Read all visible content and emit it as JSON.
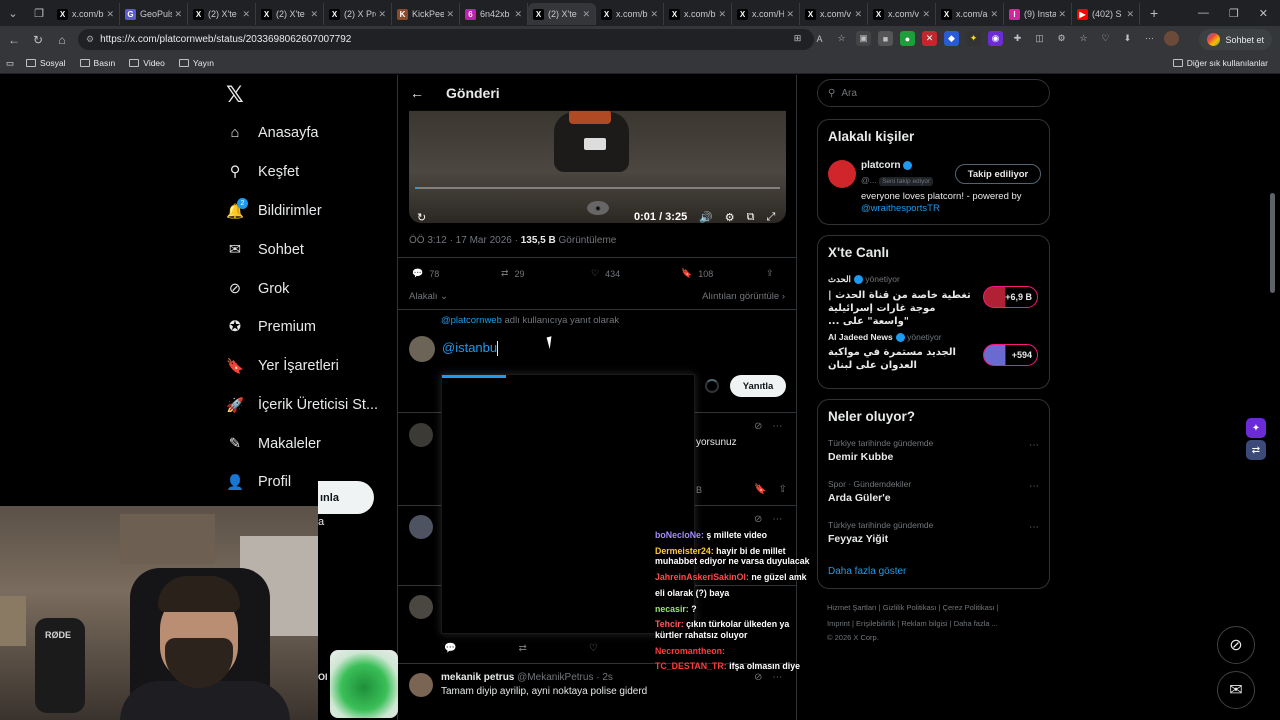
{
  "browser": {
    "tabs": [
      {
        "title": "x.com/b",
        "favicon": "X",
        "color": "#000000"
      },
      {
        "title": "GeoPuls",
        "favicon": "G",
        "color": "#5b5bd6"
      },
      {
        "title": "(2) X'te",
        "favicon": "X",
        "color": "#000000"
      },
      {
        "title": "(2) X'te",
        "favicon": "X",
        "color": "#000000"
      },
      {
        "title": "(2) X Pro",
        "favicon": "X",
        "color": "#000000"
      },
      {
        "title": "KickPee",
        "favicon": "K",
        "color": "#8a4b2a"
      },
      {
        "title": "6n42xb",
        "favicon": "6",
        "color": "#c21fb5"
      },
      {
        "title": "(2) X'te",
        "favicon": "X",
        "color": "#000000"
      },
      {
        "title": "x.com/b",
        "favicon": "X",
        "color": "#000000"
      },
      {
        "title": "x.com/b",
        "favicon": "X",
        "color": "#000000"
      },
      {
        "title": "x.com/H",
        "favicon": "X",
        "color": "#000000"
      },
      {
        "title": "x.com/v",
        "favicon": "X",
        "color": "#000000"
      },
      {
        "title": "x.com/v",
        "favicon": "X",
        "color": "#000000"
      },
      {
        "title": "x.com/a",
        "favicon": "X",
        "color": "#000000"
      },
      {
        "title": "(9) Insta",
        "favicon": "I",
        "color": "#d6249f"
      },
      {
        "title": "(402) S",
        "favicon": "▶",
        "color": "#ff0000"
      }
    ],
    "active_tab_index": 7,
    "url": "https://x.com/platcornweb/status/2033698062607007792",
    "chat_button": "Sohbet et",
    "bookmarks": [
      "Sosyal",
      "Basın",
      "Video",
      "Yayın"
    ],
    "other_bookmarks": "Diğer sık kullanılanlar"
  },
  "nav": {
    "items": [
      {
        "label": "Anasayfa",
        "icon": "home-icon",
        "glyph": "⌂"
      },
      {
        "label": "Keşfet",
        "icon": "search-icon",
        "glyph": "⚲"
      },
      {
        "label": "Bildirimler",
        "icon": "bell-icon",
        "glyph": "🔔",
        "badge": "2"
      },
      {
        "label": "Sohbet",
        "icon": "mail-icon",
        "glyph": "✉"
      },
      {
        "label": "Grok",
        "icon": "grok-icon",
        "glyph": "⊘"
      },
      {
        "label": "Premium",
        "icon": "premium-icon",
        "glyph": "✪"
      },
      {
        "label": "Yer İşaretleri",
        "icon": "bookmark-icon",
        "glyph": "🔖"
      },
      {
        "label": "İçerik Üreticisi St...",
        "icon": "rocket-icon",
        "glyph": "🚀"
      },
      {
        "label": "Makaleler",
        "icon": "article-icon",
        "glyph": "✎"
      },
      {
        "label": "Profil",
        "icon": "profile-icon",
        "glyph": "👤"
      }
    ],
    "post_button_partial": "ınla",
    "more_partial": "a"
  },
  "post": {
    "header": "Gönderi",
    "video_time": "0:01 / 3:25",
    "date": "ÖÖ 3:12 · 17 Mar 2026 · ",
    "views_count": "135,5 B",
    "views_label": " Görüntüleme",
    "replies": "78",
    "reposts": "29",
    "likes": "434",
    "bookmarks": "108",
    "relevance": "Alakalı",
    "quotes_link": "Alıntıları görüntüle",
    "reply_to_prefix": "@platcornweb",
    "reply_to_suffix": " adlı kullanıcıya yanıt olarak",
    "compose_text": "@istanbu",
    "reply_button": "Yanıtla",
    "frag1": "yorsunuz",
    "frag2": "B",
    "frag_tweet_icons_count": "",
    "mention_tweet": {
      "name": "mekanik petrus",
      "handle": "@MekanikPetrus · 2s",
      "body": "Tamam diyip ayrilip, ayni noktaya polise giderd"
    }
  },
  "stream_chat": [
    {
      "user": "boNecloNe:",
      "text": "ş millete video",
      "cls": "u1"
    },
    {
      "user": "Dermeister24:",
      "text": "hayir bi de millet muhabbet ediyor ne varsa duyulacak",
      "cls": "u2"
    },
    {
      "user": "JahreinAskeriSakinOl:",
      "text": "ne güzel amk",
      "cls": "u3"
    },
    {
      "user": "",
      "text": "eli olarak (?) baya",
      "cls": "t"
    },
    {
      "user": "necasir:",
      "text": "?",
      "cls": "u4"
    },
    {
      "user": "Tehcir:",
      "text": "çıkın türkolar ülkeden ya kürtler rahatsız oluyor",
      "cls": "u5"
    },
    {
      "user": "Necromantheon:",
      "text": "",
      "cls": "u6"
    },
    {
      "user": "TC_DESTAN_TR:",
      "text": "ifşa olmasın diye",
      "cls": "u6"
    }
  ],
  "right": {
    "search_placeholder": "Ara",
    "people_title": "Alakalı kişiler",
    "person_name": "platcorn",
    "person_handle": "@...",
    "follows_you": "Seni takip ediyor",
    "follow_button": "Takip ediliyor",
    "bio": "everyone loves platcorn! - powered by ",
    "bio_link": "@wraithesportsTR",
    "live_title": "X'te Canlı",
    "live": [
      {
        "host": "الحدث",
        "status": "yönetiyor",
        "title": "تغطية خاصة من قناة الحدث | موجة غارات إسرائيلية \"واسعة\" على ...",
        "count": "+6,9 B"
      },
      {
        "host": "Al Jadeed News",
        "status": "yönetiyor",
        "title": "الجديد مستمرة في مواكبة العدوان على لبنان",
        "count": "+594"
      }
    ],
    "trends_title": "Neler oluyor?",
    "trends": [
      {
        "category": "Türkiye tarihinde gündemde",
        "name": "Demir Kubbe"
      },
      {
        "category": "Spor · Gündemdekiler",
        "name": "Arda Güler'e"
      },
      {
        "category": "Türkiye tarihinde gündemde",
        "name": "Feyyaz Yiğit"
      }
    ],
    "show_more": "Daha fazla göster",
    "footer_line1": "Hizmet Şartları  |  Gizlilik Politikası  |  Çerez Politikası  |",
    "footer_line2": "Imprint  |  Erişilebilirlik  |  Reklam bilgisi  |  Daha fazla ...",
    "footer_line3": "© 2026 X Corp."
  },
  "cam": {
    "mic_brand": "RØDE"
  },
  "cup_label": "Ol"
}
